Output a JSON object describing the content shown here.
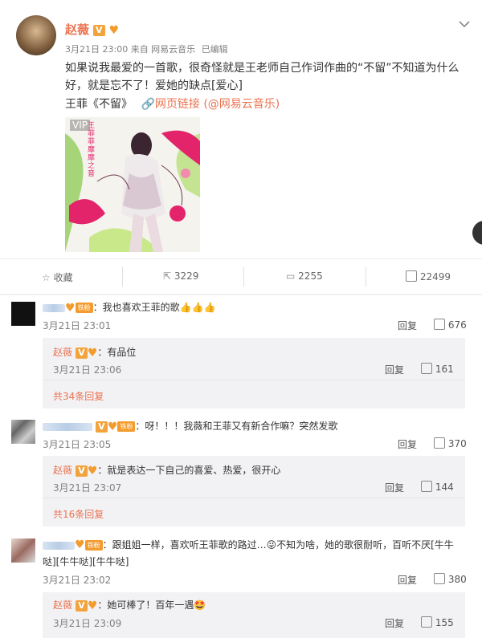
{
  "post": {
    "author": "赵薇",
    "meta": "3月21日 23:00 来自 网易云音乐",
    "edited": "已编辑",
    "text_line1": "如果说我最爱的一首歌，很奇怪就是王老师自己作词作曲的“不留”不知道为什么",
    "text_line2": "好，就是忘不了！爱她的缺点[爱心]",
    "song": "王菲《不留》",
    "link_label": "网页链接",
    "mention": "(@网易云音乐)",
    "vip_label": "VIP",
    "album_text": "王菲 菲靡靡之音"
  },
  "actions": {
    "favorite": "收藏",
    "repost": "3229",
    "comment": "2255",
    "like": "22499"
  },
  "labels": {
    "reply": "回复",
    "fan_badge": "铁粉",
    "v_badge": "V"
  },
  "comments": [
    {
      "text": "：我也喜欢王菲的歌👍👍👍",
      "time": "3月21日 23:01",
      "likes": "676",
      "reply": {
        "author": "赵薇",
        "text": "：有品位",
        "time": "3月21日 23:06",
        "likes": "161"
      },
      "more": "共34条回复"
    },
    {
      "text": "：呀！！！我薇和王菲又有新合作嘛？突然发歌",
      "time": "3月21日 23:05",
      "likes": "370",
      "reply": {
        "author": "赵薇",
        "text": "：就是表达一下自己的喜爱、热爱，很开心",
        "time": "3月21日 23:07",
        "likes": "144"
      },
      "more": "共16条回复"
    },
    {
      "text_line1": "：跟姐姐一样，喜欢听王菲歌的路过…😜不知为啥，她的歌很耐听，百听不厌[牛牛",
      "text_line2": "哒][牛牛哒][牛牛哒]",
      "time": "3月21日 23:02",
      "likes": "380",
      "reply": {
        "author": "赵薇",
        "text": "：她可棒了！百年一遇🤩",
        "time": "3月21日 23:09",
        "likes": "155"
      }
    }
  ],
  "colors": {
    "accent": "#eb7350",
    "link": "#eb7350",
    "badge": "#f3a33b"
  }
}
